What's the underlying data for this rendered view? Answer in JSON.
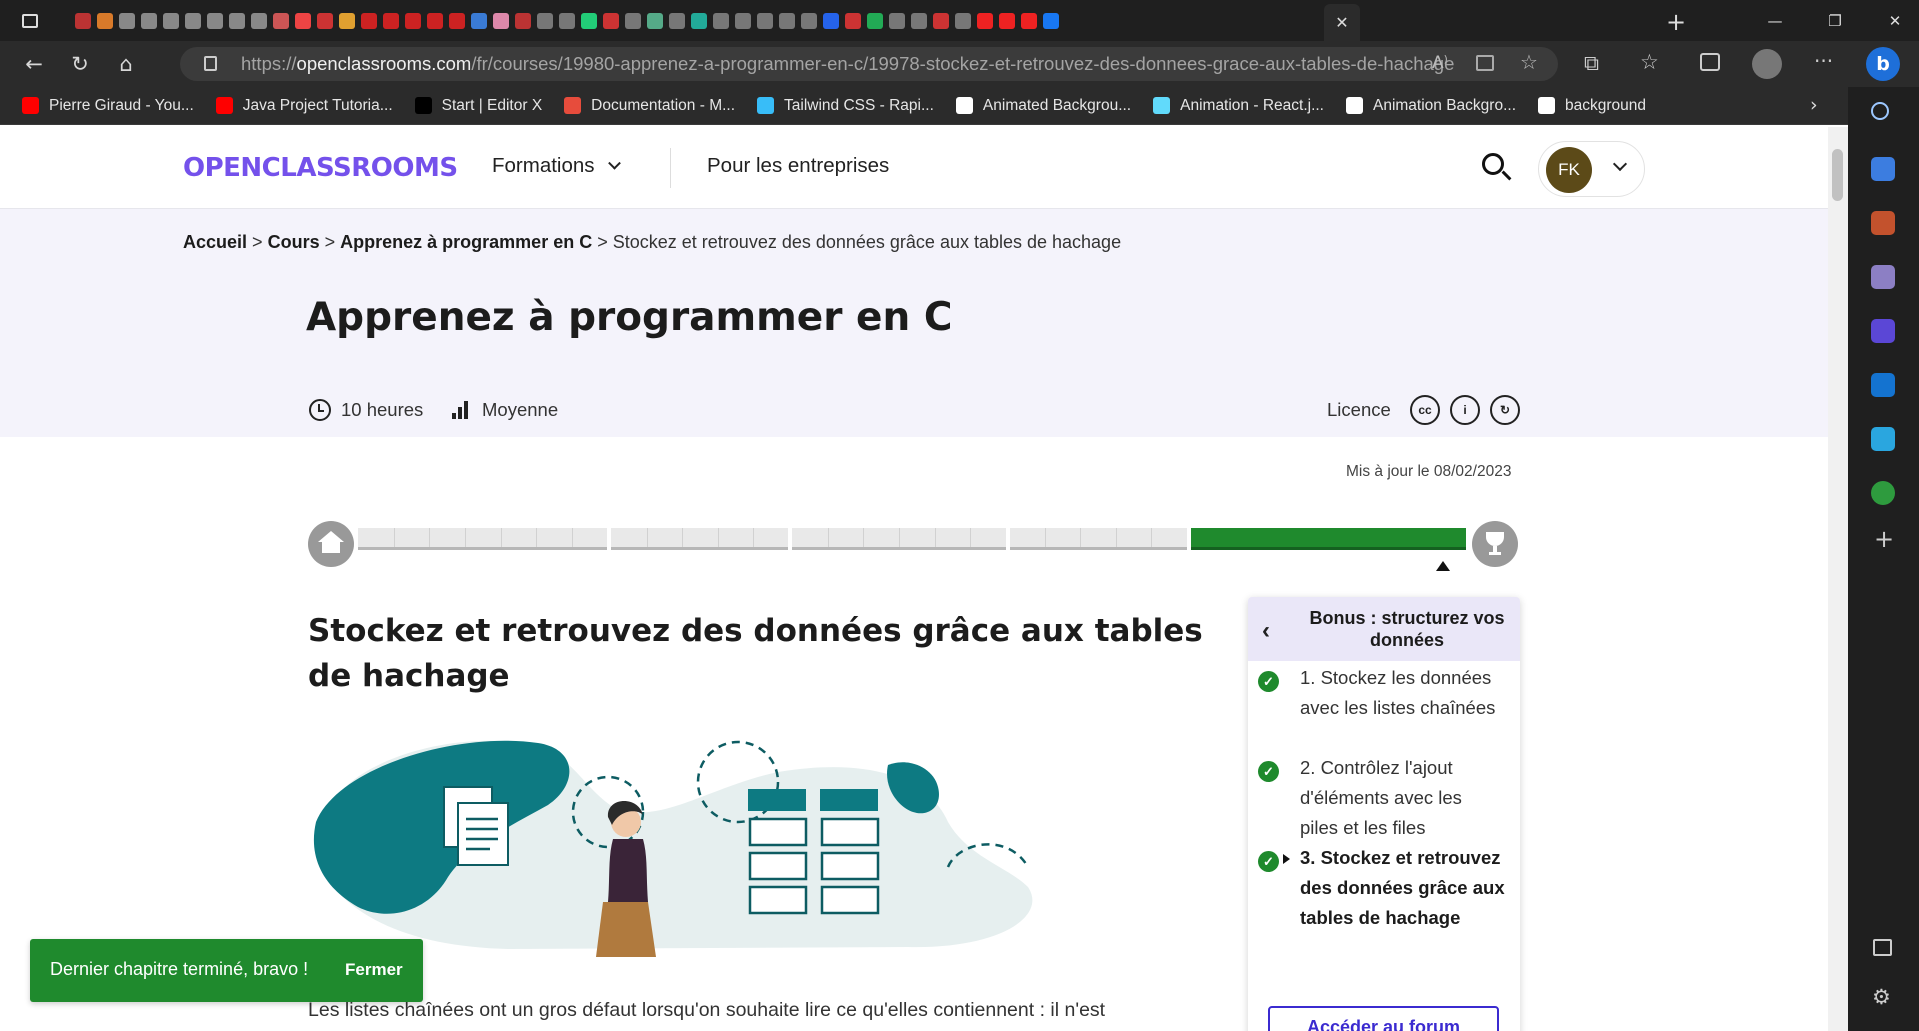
{
  "browser": {
    "url_domain": "openclassrooms.com",
    "url_path": "/fr/courses/19980-apprenez-a-programmer-en-c/19978-stockez-et-retrouvez-des-donnees-grace-aux-tables-de-hachage",
    "url_scheme": "https://",
    "bookmarks": [
      {
        "label": "Pierre Giraud - You...",
        "icon": "youtube-icon",
        "color": "#ff0000"
      },
      {
        "label": "Java Project Tutoria...",
        "icon": "youtube-icon",
        "color": "#ff0000"
      },
      {
        "label": "Start | Editor X",
        "icon": "x-icon",
        "color": "#000000"
      },
      {
        "label": "Documentation - M...",
        "icon": "mui-icon",
        "color": "#e74c3c"
      },
      {
        "label": "Tailwind CSS - Rapi...",
        "icon": "tailwind-icon",
        "color": "#38bdf8"
      },
      {
        "label": "Animated Backgrou...",
        "icon": "codepen-icon",
        "color": "#ffffff"
      },
      {
        "label": "Animation - React.j...",
        "icon": "react-icon",
        "color": "#61dafb"
      },
      {
        "label": "Animation Backgro...",
        "icon": "codepen-icon",
        "color": "#ffffff"
      },
      {
        "label": "background",
        "icon": "codepen-icon",
        "color": "#ffffff"
      }
    ]
  },
  "site": {
    "logo": "OPENCLASSROOMS",
    "nav_formations": "Formations",
    "nav_entreprises": "Pour les entreprises",
    "avatar_initials": "FK",
    "accent": "#7451eb"
  },
  "hero": {
    "breadcrumb": [
      "Accueil",
      "Cours",
      "Apprenez à programmer en C"
    ],
    "breadcrumb_current": "Stockez et retrouvez des données grâce aux tables de hachage",
    "sep": ">",
    "course_title": "Apprenez à programmer en C",
    "duration": "10 heures",
    "level": "Moyenne",
    "license_label": "Licence",
    "license_icons": [
      "cc-icon",
      "attribution-icon",
      "share-alike-icon"
    ]
  },
  "content": {
    "updated": "Mis à jour le 08/02/2023",
    "chapter_title": "Stockez et retrouvez des données grâce aux tables de hachage",
    "body_text": "Les listes chaînées ont un gros défaut lorsqu'on souhaite lire ce qu'elles contiennent : il n'est",
    "progress_parts": [
      7,
      5,
      6,
      5,
      3
    ],
    "progress_done_parts": [
      false,
      false,
      false,
      false,
      true
    ]
  },
  "sidebar": {
    "title": "Bonus : structurez vos données",
    "items": [
      {
        "text": "1. Stockez les données avec les listes chaînées",
        "done": true,
        "current": false
      },
      {
        "text": "2. Contrôlez l'ajout d'éléments avec les piles et les files",
        "done": true,
        "current": false
      },
      {
        "text": "3. Stockez et retrouvez des données grâce aux tables de hachage",
        "done": true,
        "current": true
      }
    ],
    "forum_button": "Accéder au forum"
  },
  "toast": {
    "message": "Dernier chapitre terminé, bravo !",
    "close": "Fermer",
    "color": "#1f8a2d"
  }
}
